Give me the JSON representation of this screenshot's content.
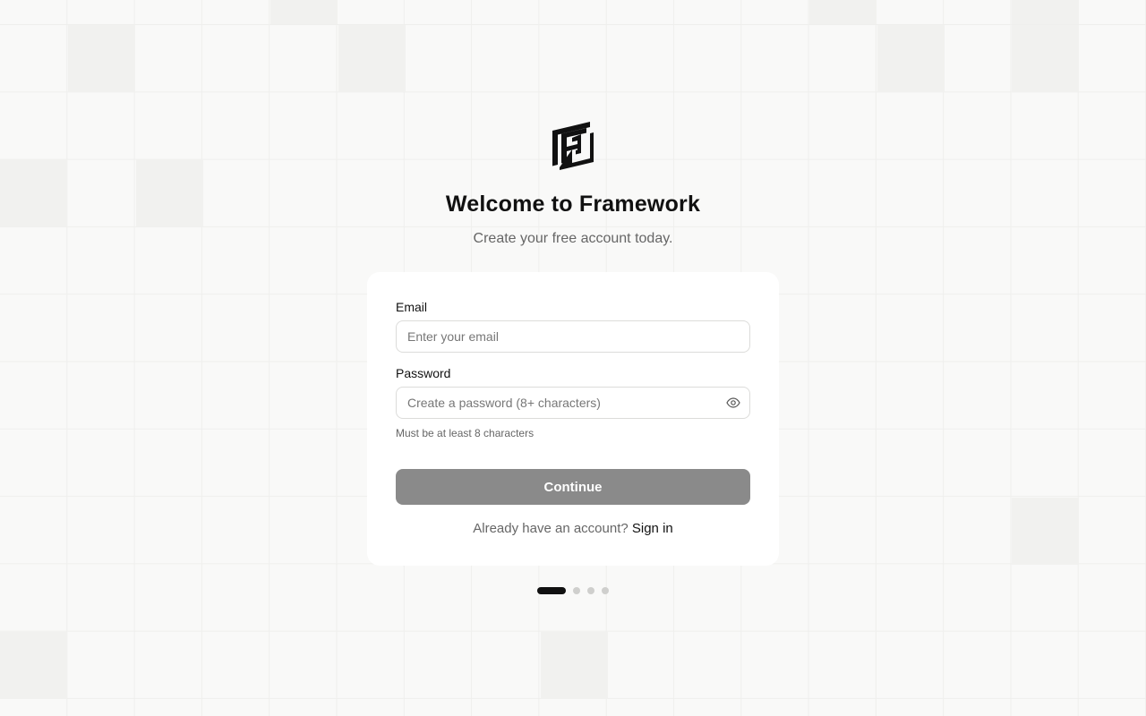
{
  "header": {
    "logo_icon": "framework-logo-icon",
    "title": "Welcome to Framework",
    "subtitle": "Create your free account today."
  },
  "form": {
    "email_label": "Email",
    "email_placeholder": "Enter your email",
    "email_value": "",
    "password_label": "Password",
    "password_placeholder": "Create a password (8+ characters)",
    "password_value": "",
    "password_toggle_icon": "eye-icon",
    "password_hint": "Must be at least 8 characters",
    "continue_label": "Continue",
    "signin_prompt": "Already have an account?",
    "signin_link": "Sign in"
  },
  "pagination": {
    "total_steps": 4,
    "current_step": 1
  },
  "colors": {
    "background": "#f9f9f8",
    "card": "#ffffff",
    "button_disabled": "#8a8a8a",
    "text_primary": "#111111",
    "text_muted": "#666666"
  }
}
